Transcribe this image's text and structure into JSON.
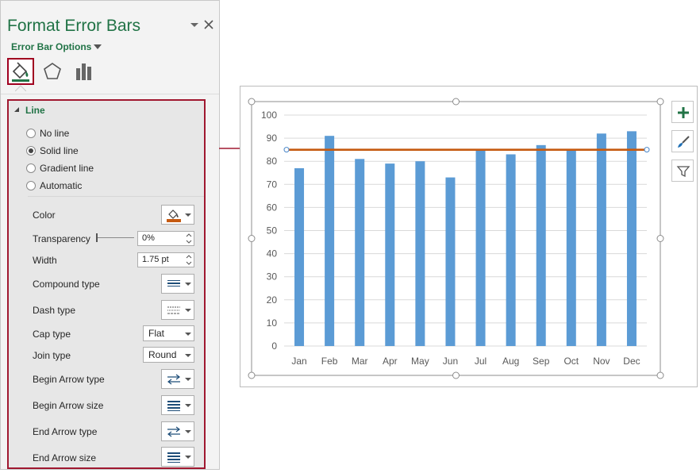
{
  "pane": {
    "title": "Format Error Bars",
    "subtitle": "Error Bar Options",
    "tabs": [
      {
        "icon": "fill-line-icon",
        "active": true
      },
      {
        "icon": "effects-pentagon-icon",
        "active": false
      },
      {
        "icon": "bar-options-icon",
        "active": false
      }
    ],
    "accent_color": "#217346",
    "highlight_color": "#a01830"
  },
  "line_section": {
    "title": "Line",
    "options": [
      "No line",
      "Solid line",
      "Gradient line",
      "Automatic"
    ],
    "selected": "Solid line",
    "color_label": "Color",
    "line_color": "#c55a11",
    "transparency_label": "Transparency",
    "transparency_value": "0%",
    "width_label": "Width",
    "width_value": "1.75 pt",
    "compound_label": "Compound type",
    "dash_label": "Dash type",
    "cap_label": "Cap type",
    "cap_value": "Flat",
    "join_label": "Join type",
    "join_value": "Round",
    "begin_arrow_type_label": "Begin Arrow type",
    "begin_arrow_size_label": "Begin Arrow size",
    "end_arrow_type_label": "End Arrow type",
    "end_arrow_size_label": "End Arrow size"
  },
  "chart_data": {
    "type": "bar",
    "categories": [
      "Jan",
      "Feb",
      "Mar",
      "Apr",
      "May",
      "Jun",
      "Jul",
      "Aug",
      "Sep",
      "Oct",
      "Nov",
      "Dec"
    ],
    "values": [
      77,
      91,
      81,
      79,
      80,
      73,
      85,
      83,
      87,
      85,
      92,
      93
    ],
    "y_ticks": [
      0,
      10,
      20,
      30,
      40,
      50,
      60,
      70,
      80,
      90,
      100
    ],
    "ylim": [
      0,
      100
    ],
    "reference_line": 85,
    "bar_color": "#5b9bd5",
    "line_color": "#c55a11",
    "grid": true,
    "title": "",
    "xlabel": "",
    "ylabel": ""
  },
  "chart_tools": [
    "chart-elements-plus-icon",
    "chart-styles-brush-icon",
    "chart-filters-funnel-icon"
  ]
}
